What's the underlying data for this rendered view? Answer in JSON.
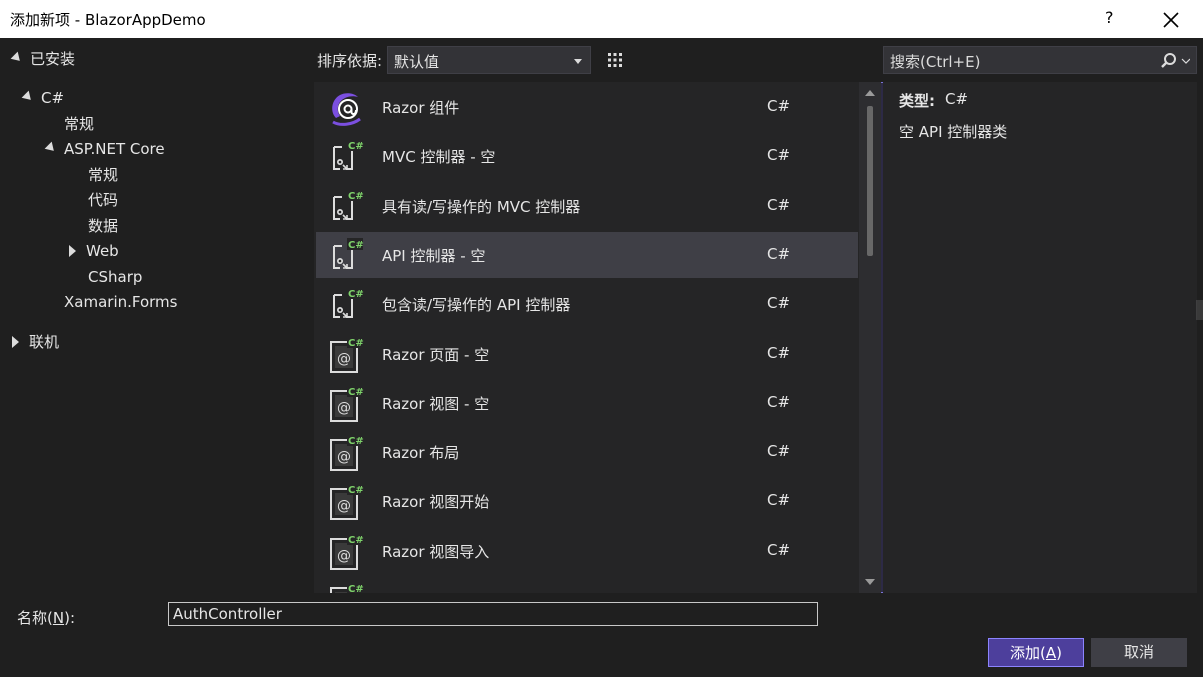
{
  "window": {
    "title": "添加新项 - BlazorAppDemo",
    "help": "?"
  },
  "tree": {
    "installed": "已安装",
    "csharp": "C#",
    "general": "常规",
    "aspnet": "ASP.NET Core",
    "aspnet_children": [
      "常规",
      "代码",
      "数据",
      "Web",
      "CSharp"
    ],
    "xamarin": "Xamarin.Forms",
    "online": "联机"
  },
  "sort": {
    "label": "排序依据:",
    "value": "默认值"
  },
  "search": {
    "placeholder": "搜索(Ctrl+E)"
  },
  "templates": [
    {
      "name": "Razor 组件",
      "lang": "C#",
      "icon": "razor-component-icon"
    },
    {
      "name": "MVC 控制器 - 空",
      "lang": "C#",
      "icon": "controller-icon"
    },
    {
      "name": "具有读/写操作的 MVC 控制器",
      "lang": "C#",
      "icon": "controller-icon"
    },
    {
      "name": "API 控制器 - 空",
      "lang": "C#",
      "icon": "controller-icon",
      "selected": true
    },
    {
      "name": "包含读/写操作的 API 控制器",
      "lang": "C#",
      "icon": "controller-icon"
    },
    {
      "name": "Razor 页面 - 空",
      "lang": "C#",
      "icon": "razor-page-icon"
    },
    {
      "name": "Razor 视图 - 空",
      "lang": "C#",
      "icon": "razor-page-icon"
    },
    {
      "name": "Razor 布局",
      "lang": "C#",
      "icon": "razor-page-icon"
    },
    {
      "name": "Razor 视图开始",
      "lang": "C#",
      "icon": "razor-page-icon"
    },
    {
      "name": "Razor 视图导入",
      "lang": "C#",
      "icon": "razor-page-icon"
    }
  ],
  "detail": {
    "type_label": "类型:",
    "type_value": "C#",
    "description": "空 API 控制器类"
  },
  "name": {
    "label_prefix": "名称(",
    "label_key": "N",
    "label_suffix": "):",
    "value": "AuthController"
  },
  "buttons": {
    "add_prefix": "添加(",
    "add_key": "A",
    "add_suffix": ")",
    "cancel": "取消"
  },
  "colors": {
    "accent": "#8c84ff",
    "csharp_badge": "#7fd36b",
    "razor_purple": "#7b4fe0"
  }
}
